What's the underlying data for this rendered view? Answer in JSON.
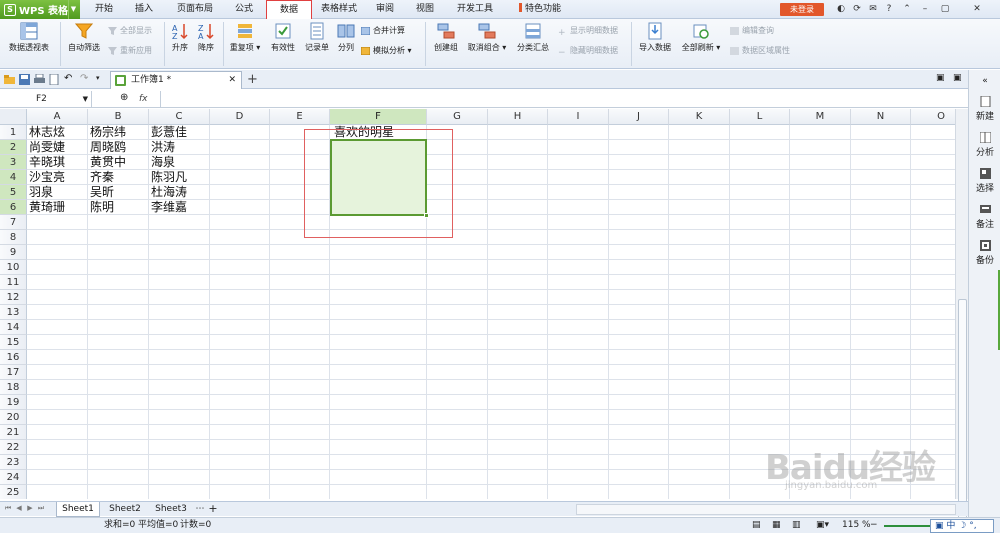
{
  "app": {
    "name": "WPS 表格",
    "login": "未登录"
  },
  "menu": [
    "开始",
    "插入",
    "页面布局",
    "公式",
    "数据",
    "表格样式",
    "审阅",
    "视图",
    "开发工具",
    "特色功能"
  ],
  "active_menu": "数据",
  "ribbon": {
    "pivot": "数据透视表",
    "autofilter": "自动筛选",
    "show_all": "全部显示",
    "reapply": "重新应用",
    "sort_asc": "升序",
    "sort_desc": "降序",
    "duplicates": "重复项",
    "validity": "有效性",
    "record_form": "记录单",
    "split": "分列",
    "consolidate": "合并计算",
    "simulate": "模拟分析",
    "group": "创建组",
    "ungroup": "取消组合",
    "subtotal": "分类汇总",
    "show_detail": "显示明细数据",
    "hide_detail": "隐藏明细数据",
    "import": "导入数据",
    "refresh_all": "全部刷新",
    "edit_query": "编辑查询",
    "data_range_props": "数据区域属性"
  },
  "doc_tab": "工作簿1 *",
  "name_box": "F2",
  "fx_label": "fx",
  "columns": [
    "A",
    "B",
    "C",
    "D",
    "E",
    "F",
    "G",
    "H",
    "I",
    "J",
    "K",
    "L",
    "M",
    "N",
    "O"
  ],
  "rows": [
    "1",
    "2",
    "3",
    "4",
    "5",
    "6",
    "7",
    "8",
    "9",
    "10",
    "11",
    "12",
    "13",
    "14",
    "15",
    "16",
    "17",
    "18",
    "19",
    "20",
    "21",
    "22",
    "23",
    "24",
    "25"
  ],
  "cells": {
    "A": [
      "林志炫",
      "尚雯婕",
      "辛晓琪",
      "沙宝亮",
      "羽泉",
      "黄琦珊"
    ],
    "B": [
      "杨宗纬",
      "周晓鸥",
      "黄贯中",
      "齐秦",
      "吴昕",
      "陈明"
    ],
    "C": [
      "彭薏佳",
      "洪涛",
      "海泉",
      "陈羽凡",
      "杜海涛",
      "李维嘉"
    ],
    "F1": "喜欢的明星"
  },
  "sheets": [
    "Sheet1",
    "Sheet2",
    "Sheet3"
  ],
  "status": {
    "sum": "求和=0",
    "avg": "平均值=0",
    "count": "计数=0",
    "zoom": "115 %"
  },
  "ime": "中",
  "sidebar": [
    "新建",
    "分析",
    "选择",
    "备注",
    "备份"
  ],
  "watermark": {
    "big": "Baidu经验",
    "small": "jingyan.baidu.com"
  },
  "colors": {
    "accent_green": "#5b9a32",
    "selection_fill": "#e6f3dc",
    "login_orange": "#e2572b",
    "highlight_red": "#e04040"
  }
}
